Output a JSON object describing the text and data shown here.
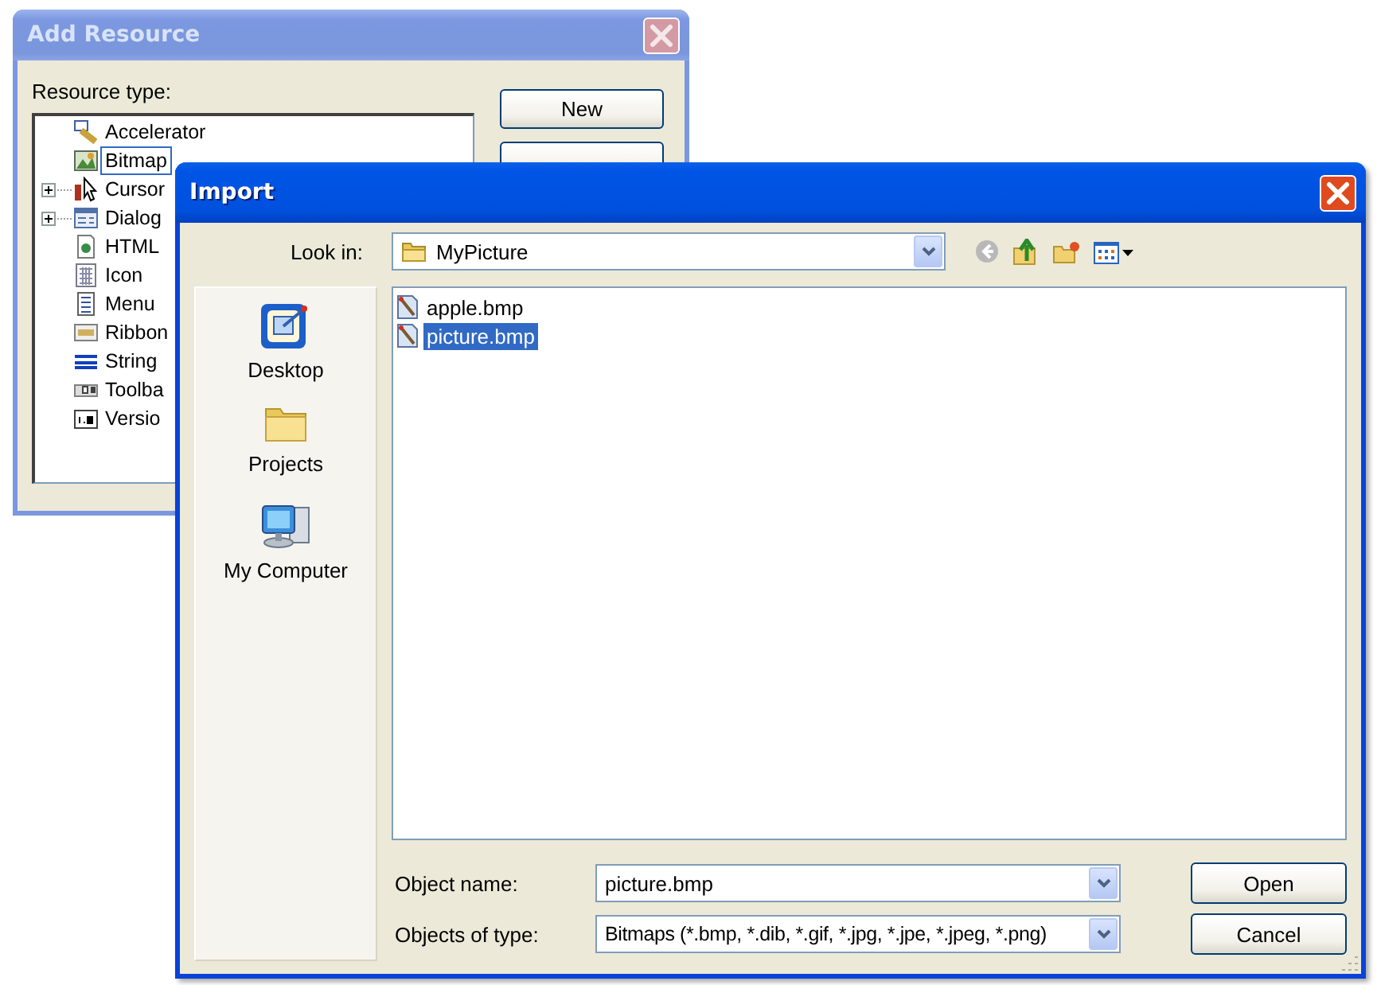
{
  "add_resource": {
    "title": "Add Resource",
    "label": "Resource type:",
    "tree": [
      {
        "label": "Accelerator",
        "kind": "accelerator",
        "expander": false,
        "focused": false
      },
      {
        "label": "Bitmap",
        "kind": "bitmap",
        "expander": false,
        "focused": true
      },
      {
        "label": "Cursor",
        "kind": "cursor",
        "expander": true,
        "focused": false
      },
      {
        "label": "Dialog",
        "kind": "dialog",
        "expander": true,
        "focused": false
      },
      {
        "label": "HTML",
        "kind": "html",
        "expander": false,
        "focused": false
      },
      {
        "label": "Icon",
        "kind": "icon",
        "expander": false,
        "focused": false
      },
      {
        "label": "Menu",
        "kind": "menu",
        "expander": false,
        "focused": false
      },
      {
        "label": "Ribbon",
        "kind": "ribbon",
        "expander": false,
        "focused": false
      },
      {
        "label": "String",
        "kind": "string",
        "expander": false,
        "focused": false
      },
      {
        "label": "Toolba",
        "kind": "toolbar",
        "expander": false,
        "focused": false
      },
      {
        "label": "Versio",
        "kind": "version",
        "expander": false,
        "focused": false
      }
    ],
    "buttons": [
      {
        "kind": "labeled",
        "label": "New"
      },
      {
        "kind": "covered"
      }
    ]
  },
  "import_dialog": {
    "title": "Import",
    "look_in": {
      "label": "Look in:",
      "value": "MyPicture"
    },
    "places": [
      {
        "label": "Desktop",
        "kind": "desktop"
      },
      {
        "label": "Projects",
        "kind": "folder"
      },
      {
        "label": "My Computer",
        "kind": "computer"
      }
    ],
    "files": [
      {
        "name": "apple.bmp",
        "selected": false
      },
      {
        "name": "picture.bmp",
        "selected": true
      }
    ],
    "object_name": {
      "label": "Object name:",
      "value": "picture.bmp"
    },
    "object_type": {
      "label": "Objects of type:",
      "value": "Bitmaps (*.bmp, *.dib, *.gif, *.jpg, *.jpe, *.jpeg, *.png)"
    },
    "buttons": [
      "Open",
      "Cancel"
    ]
  }
}
